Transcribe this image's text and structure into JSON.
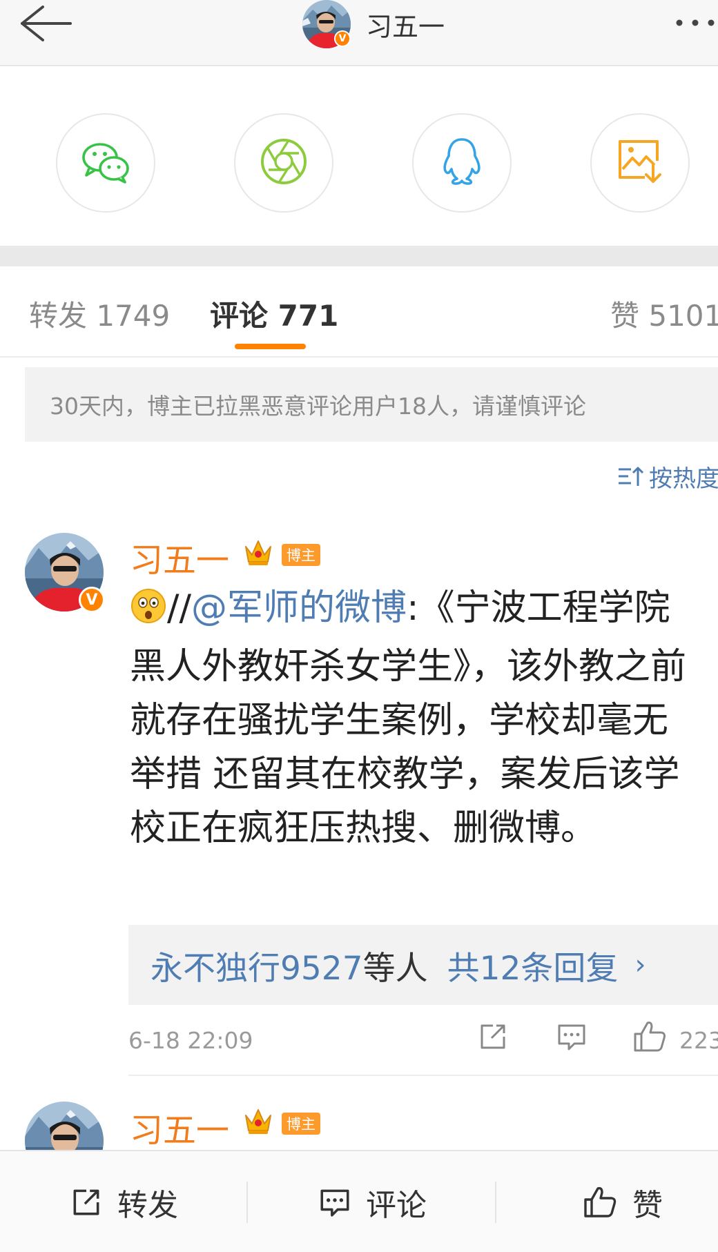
{
  "header": {
    "title": "习五一"
  },
  "share": {
    "items": [
      "wechat-icon",
      "moments-icon",
      "qq-icon",
      "save-image-icon"
    ]
  },
  "tabs": [
    {
      "label": "转发 1749"
    },
    {
      "label": "评论 771"
    },
    {
      "label": "赞 5101"
    }
  ],
  "notice": "30天内，博主已拉黑恶意评论用户18人，请谨慎评论",
  "sort": {
    "label": "按热度"
  },
  "comment": {
    "author": "习五一",
    "badge": "博主",
    "text_prefix": "//",
    "mention": "@军师的微博",
    "text_body": ":《宁波工程学院黑人外教奸杀女学生》，该外教之前就存在骚扰学生案例，学校却毫无举措 还留其在校教学，案发后该学校正在疯狂压热搜、删微博。",
    "replies": {
      "who": "永不独行9527",
      "mid": "等人",
      "count": "共12条回复",
      "chevron": "›"
    },
    "time": "6-18 22:09",
    "likes": "223"
  },
  "comment2": {
    "author": "习五一",
    "badge": "博主"
  },
  "bottombar": {
    "repost": "转发",
    "comment": "评论",
    "like": "赞"
  },
  "colors": {
    "accent": "#ff8200",
    "link": "#4f7db3",
    "name": "#f27c1c"
  }
}
